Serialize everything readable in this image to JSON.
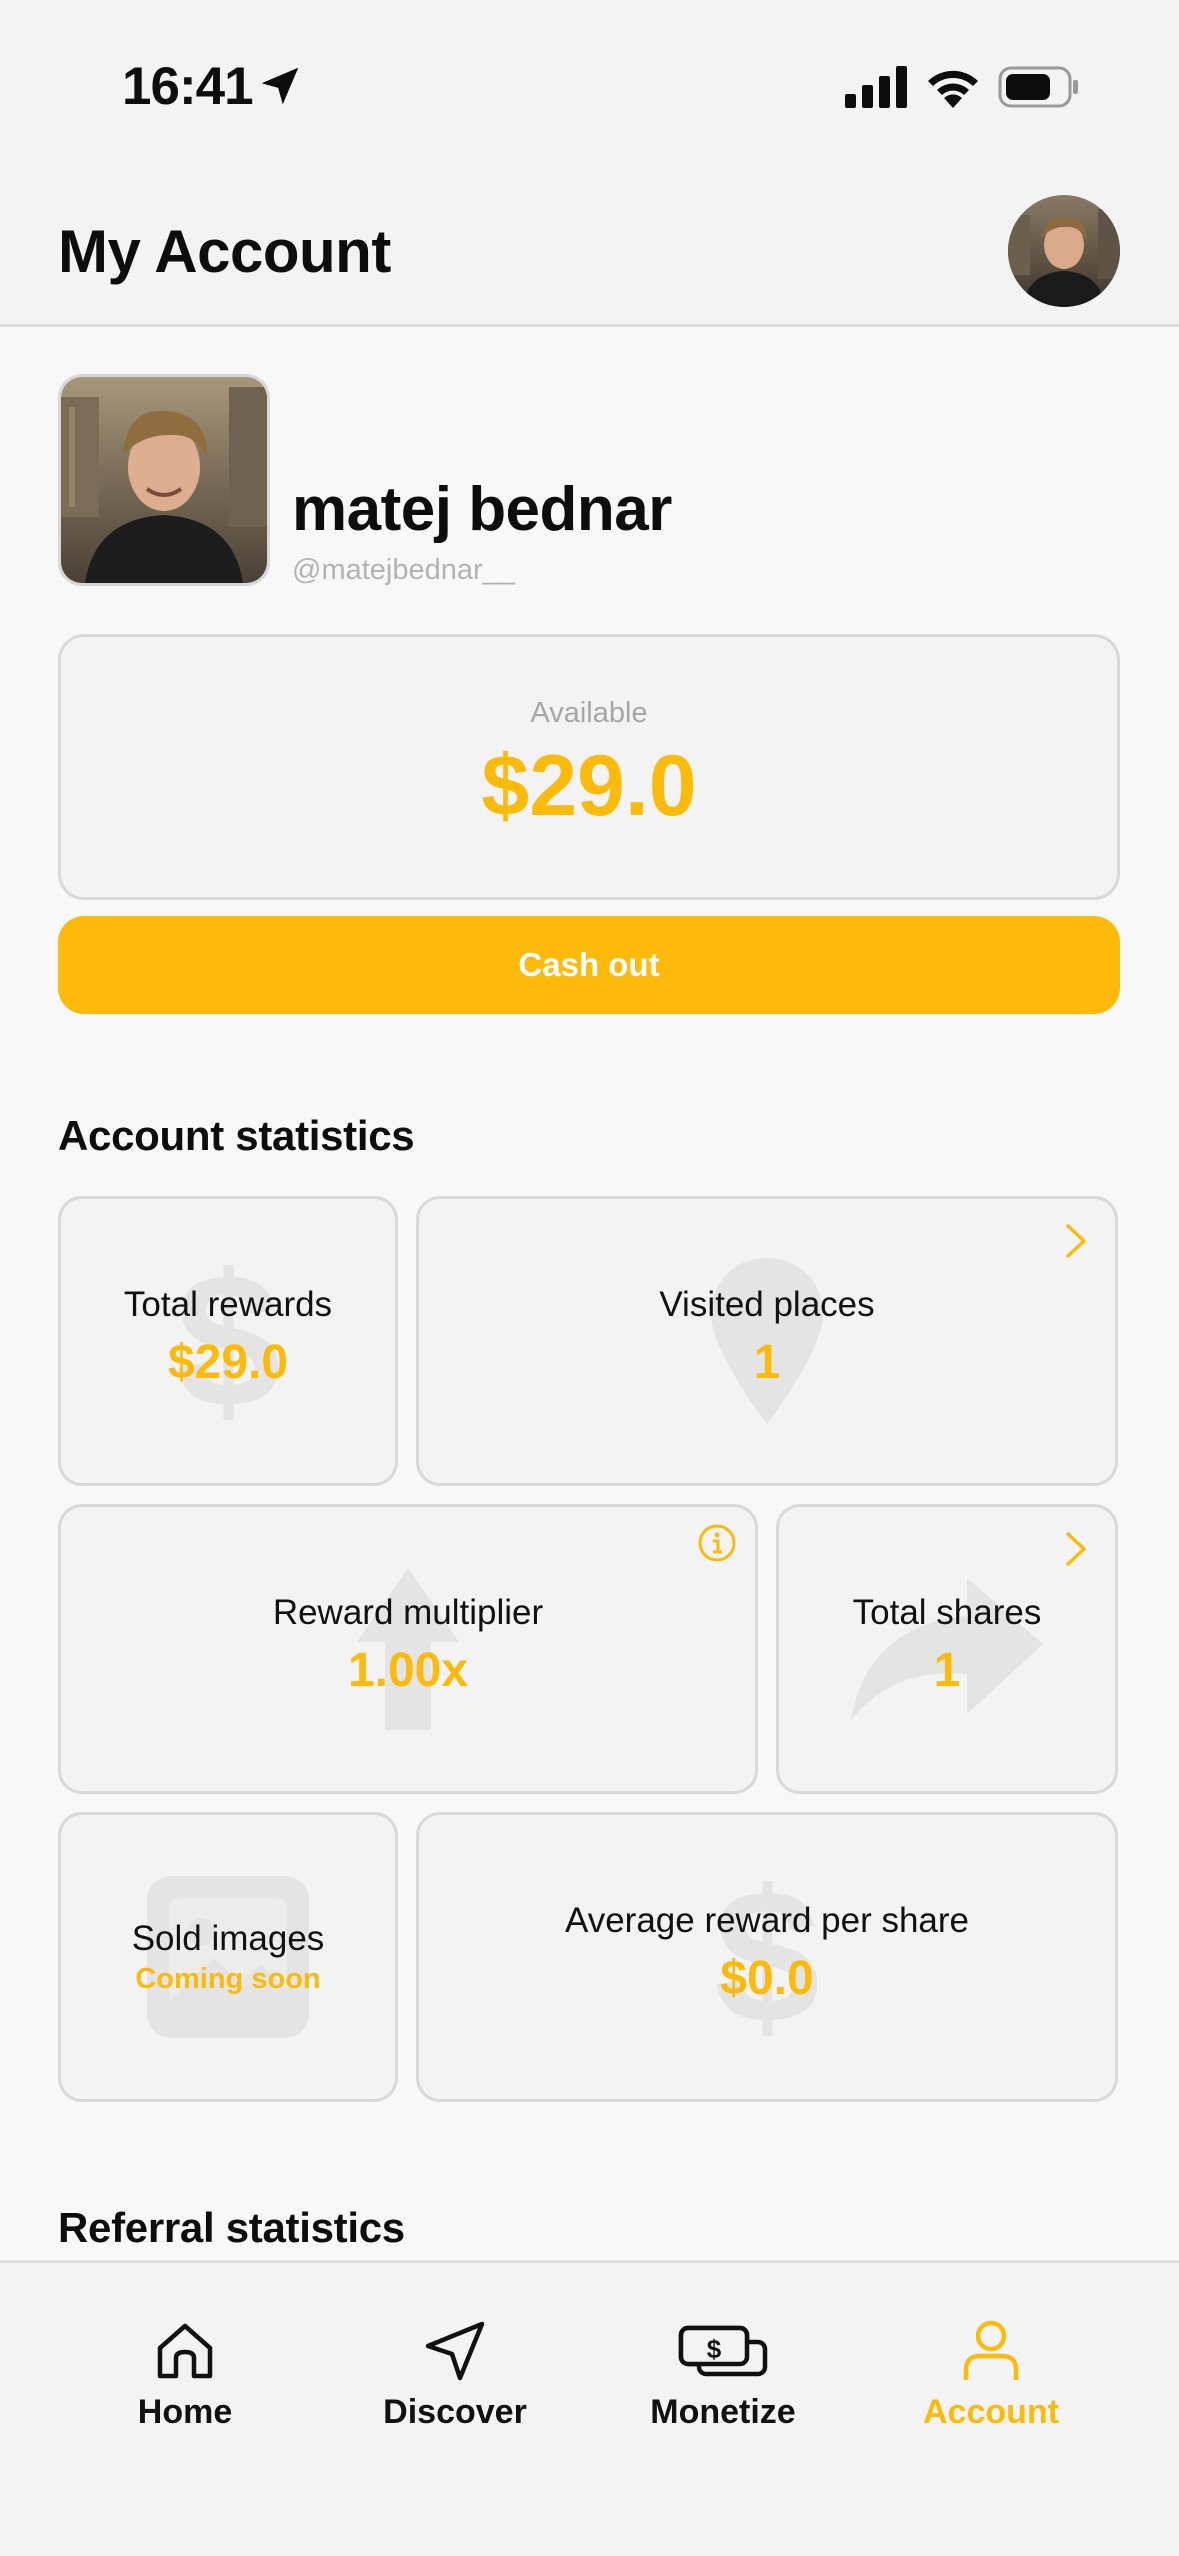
{
  "status_bar": {
    "time": "16:41"
  },
  "header": {
    "title": "My Account"
  },
  "profile": {
    "name": "matej bednar",
    "handle": "@matejbednar__"
  },
  "balance": {
    "label": "Available",
    "amount": "$29.0"
  },
  "cashout": {
    "label": "Cash out"
  },
  "account_statistics": {
    "title": "Account statistics",
    "total_rewards": {
      "label": "Total rewards",
      "value": "$29.0",
      "icon": "dollar-icon"
    },
    "visited_places": {
      "label": "Visited places",
      "value": "1",
      "icon": "map-pin-icon"
    },
    "reward_multiplier": {
      "label": "Reward multiplier",
      "value": "1.00x",
      "icon": "arrow-up-icon"
    },
    "total_shares": {
      "label": "Total shares",
      "value": "1",
      "icon": "share-icon"
    },
    "sold_images": {
      "label": "Sold images",
      "note": "Coming soon",
      "icon": "image-icon"
    },
    "average_reward": {
      "label": "Average reward per share",
      "value": "$0.0",
      "icon": "dollar-icon"
    }
  },
  "referral_statistics": {
    "title": "Referral statistics"
  },
  "tab_bar": {
    "tabs": [
      {
        "label": "Home",
        "icon": "home-icon"
      },
      {
        "label": "Discover",
        "icon": "navigation-icon"
      },
      {
        "label": "Monetize",
        "icon": "money-icon"
      },
      {
        "label": "Account",
        "icon": "user-icon"
      }
    ],
    "active_index": 3
  },
  "colors": {
    "accent": "#fbbb0c",
    "card_bg": "#f3f3f3",
    "card_border": "#d9d9d9",
    "watermark": "#e4e4e4"
  }
}
